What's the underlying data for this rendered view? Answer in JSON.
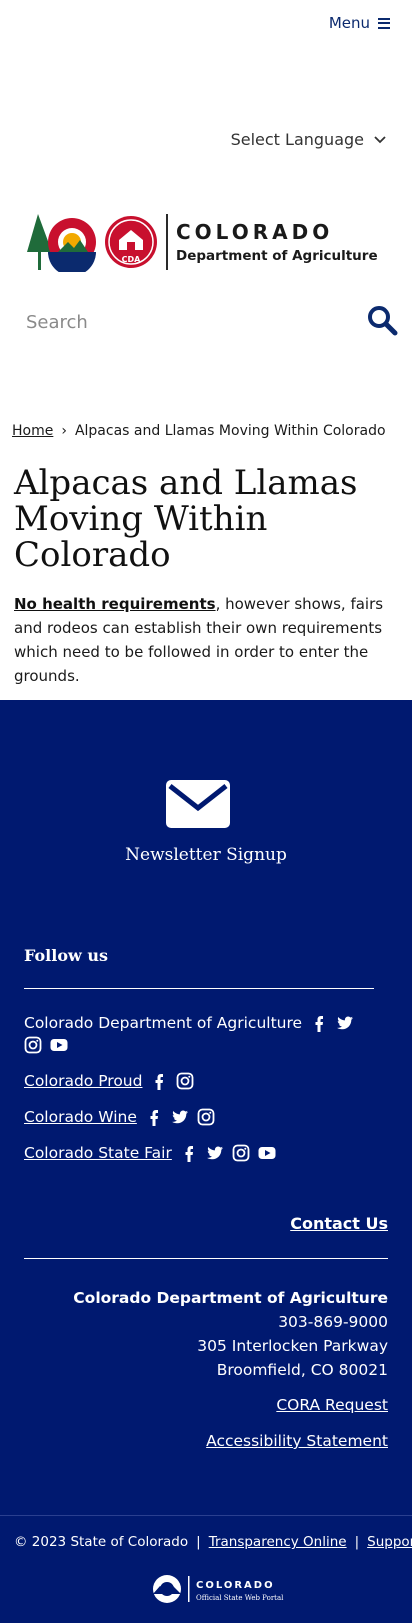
{
  "header": {
    "menu_label": "Menu",
    "language_label": "Select Language",
    "logo_title": "COLORADO",
    "logo_subtitle": "Department of Agriculture",
    "logo_badge": "CDA"
  },
  "search": {
    "placeholder": "Search"
  },
  "breadcrumb": {
    "home": "Home",
    "separator": "›",
    "current": "Alpacas and Llamas Moving Within Colorado"
  },
  "page": {
    "title": "Alpacas and Llamas Moving Within Colorado",
    "intro_link": "No health requirements",
    "intro_rest": ", however shows, fairs and rodeos can establish their own requirements which need to be followed in order to enter the grounds."
  },
  "footer": {
    "newsletter_label": "Newsletter Signup",
    "follow_heading": "Follow us",
    "social": [
      {
        "name": "Colorado Department of Agriculture",
        "icons": [
          "facebook-icon",
          "twitter-icon",
          "instagram-icon",
          "youtube-icon"
        ]
      },
      {
        "name": "Colorado Proud",
        "icons": [
          "facebook-icon",
          "instagram-icon"
        ]
      },
      {
        "name": "Colorado Wine",
        "icons": [
          "facebook-icon",
          "twitter-icon",
          "instagram-icon"
        ]
      },
      {
        "name": "Colorado State Fair",
        "icons": [
          "facebook-icon",
          "twitter-icon",
          "instagram-icon",
          "youtube-icon"
        ]
      }
    ],
    "contact_label": "Contact Us",
    "org_name": "Colorado Department of Agriculture",
    "phone": "303-869-9000",
    "street": "305 Interlocken Parkway",
    "city": "Broomfield, CO 80021",
    "cora_label": "CORA Request",
    "accessibility_label": "Accessibility Statement"
  },
  "legal": {
    "copyright": "© 2023 State of Colorado",
    "sep": "|",
    "transparency": "Transparency Online",
    "support": "Support",
    "portal_title": "COLORADO",
    "portal_subtitle": "Official State Web Portal"
  },
  "colors": {
    "brand_navy": "#001970",
    "link_navy": "#0b2a6e"
  }
}
